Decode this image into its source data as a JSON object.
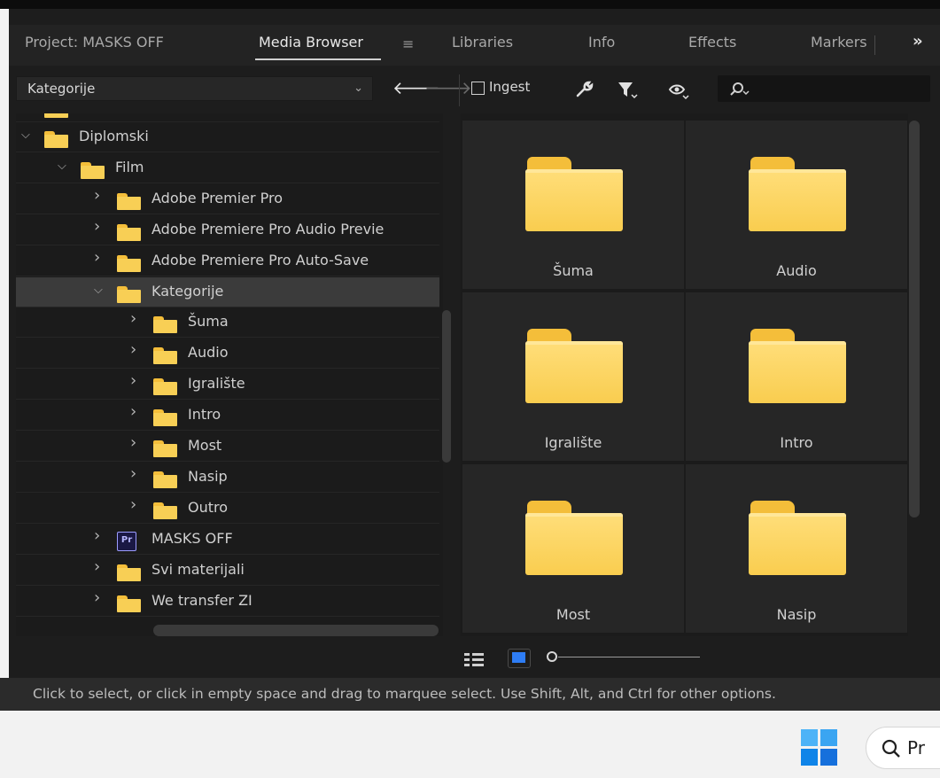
{
  "tabs": [
    {
      "label": "Project: MASKS OFF"
    },
    {
      "label": "Media Browser"
    },
    {
      "label": "Libraries"
    },
    {
      "label": "Info"
    },
    {
      "label": "Effects"
    },
    {
      "label": "Markers"
    }
  ],
  "tab_menu_icon": "≡",
  "overflow_icon": "»",
  "toolbar": {
    "location": "Kategorije",
    "ingest_label": "Ingest"
  },
  "tree": [
    {
      "label": "Diplomski",
      "expanded": true
    },
    {
      "label": "Film",
      "expanded": true
    },
    {
      "label": "Adobe Premier Pro"
    },
    {
      "label": "Adobe Premiere Pro Audio Previe"
    },
    {
      "label": "Adobe Premiere Pro Auto-Save"
    },
    {
      "label": "Kategorije",
      "expanded": true,
      "selected": true
    },
    {
      "label": "Šuma"
    },
    {
      "label": "Audio"
    },
    {
      "label": "Igralište"
    },
    {
      "label": "Intro"
    },
    {
      "label": "Most"
    },
    {
      "label": "Nasip"
    },
    {
      "label": "Outro"
    },
    {
      "label": "MASKS OFF",
      "icon": "Pr"
    },
    {
      "label": "Svi materijali"
    },
    {
      "label": "We transfer ZI"
    }
  ],
  "grid": [
    {
      "label": "Šuma"
    },
    {
      "label": "Audio"
    },
    {
      "label": "Igralište"
    },
    {
      "label": "Intro"
    },
    {
      "label": "Most"
    },
    {
      "label": "Nasip"
    }
  ],
  "status_text": "Click to select, or click in empty space and drag to marquee select. Use Shift, Alt, and Ctrl for other options.",
  "taskbar": {
    "search_text": "Pr"
  },
  "colors": {
    "folder": "#f8cf55",
    "accent": "#2e7df5",
    "selected_row": "#3b3b3b"
  }
}
